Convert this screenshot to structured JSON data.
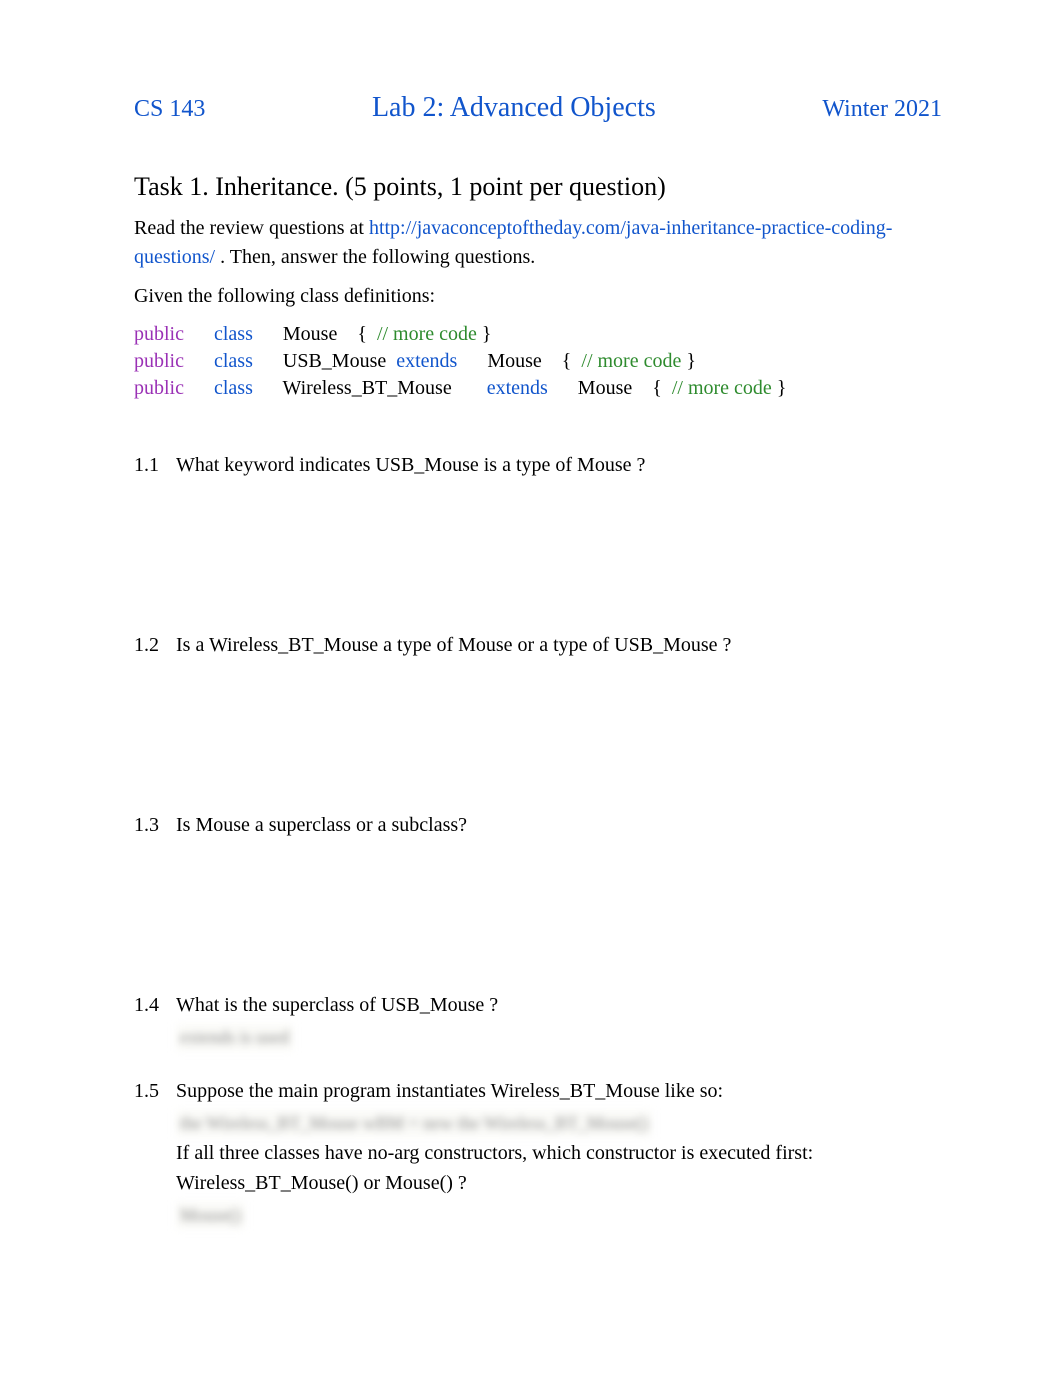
{
  "header": {
    "left": "CS 143",
    "center": "Lab 2: Advanced Objects",
    "right": "Winter 2021"
  },
  "task_title": "Task 1.  Inheritance. (5 points, 1 point per question)",
  "intro_pre": "Read the review questions at  ",
  "intro_link": "http://javaconceptoftheday.com/java-inheritance-practice-coding-questions/",
  "intro_post": " .   Then, answer the following questions.",
  "given_line": "Given the following class definitions:",
  "code": {
    "l1": {
      "vis": "public",
      "cls": "class",
      "rest1": "Mouse    { ",
      "cm": "// more code",
      "rest2": " }"
    },
    "l2": {
      "vis": "public",
      "cls": "class",
      "name": "USB_Mouse ",
      "ext": "extends",
      "name2": "      Mouse    { ",
      "cm": "// more code",
      "rest2": " }"
    },
    "l3": {
      "vis": "public",
      "cls": "class",
      "name": "Wireless_BT_Mouse       ",
      "ext": "extends",
      "name2": "      Mouse    { ",
      "cm": "// more code",
      "rest2": " }"
    }
  },
  "q": {
    "n1": "1.1",
    "t1": "What keyword indicates  USB_Mouse  is a type of Mouse ?",
    "n2": "1.2",
    "t2": "Is a Wireless_BT_Mouse        a type of  Mouse  or a type of  USB_Mouse ?",
    "n3": "1.3",
    "t3": "Is Mouse  a superclass or a subclass?",
    "n4": "1.4",
    "t4": "What is the superclass of  USB_Mouse ?",
    "n5": "1.5",
    "t5a": "Suppose the main program instantiates    Wireless_BT_Mouse         like so:",
    "t5b": "If all three classes have no-arg constructors, which constructor is executed first:",
    "t5c": "Wireless_BT_Mouse()         or Mouse()   ?"
  },
  "blur": {
    "a": "extends is used",
    "b": "the Wireless_BT_Mouse wBM   =   new   the Wireless_BT_Mouse()",
    "c": "Mouse()"
  }
}
